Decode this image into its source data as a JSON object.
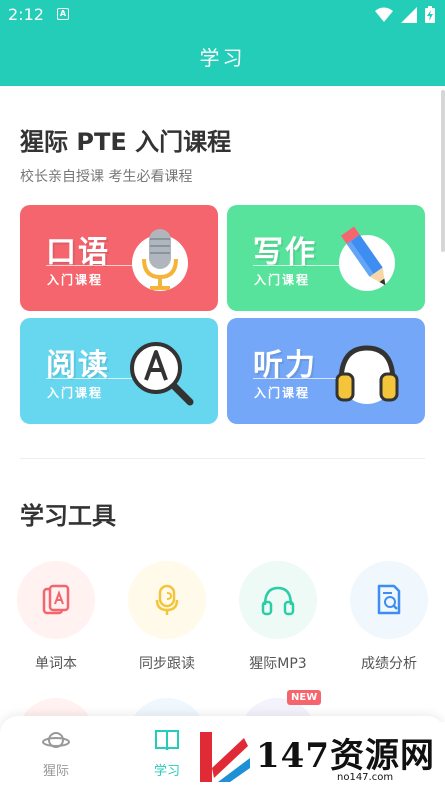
{
  "status_bar": {
    "time": "2:12",
    "notification_letter": "A"
  },
  "header": {
    "title": "学习"
  },
  "course_section": {
    "title": "猩际 PTE 入门课程",
    "subtitle": "校长亲自授课 考生必看课程",
    "cards": [
      {
        "title": "口语",
        "subtitle": "入门课程",
        "color": "#f4656e",
        "icon": "microphone-icon"
      },
      {
        "title": "写作",
        "subtitle": "入门课程",
        "color": "#58e39c",
        "icon": "pencil-icon"
      },
      {
        "title": "阅读",
        "subtitle": "入门课程",
        "color": "#67d6ef",
        "icon": "magnifier-icon"
      },
      {
        "title": "听力",
        "subtitle": "入门课程",
        "color": "#74a7f7",
        "icon": "headphones-icon"
      }
    ]
  },
  "tools_section": {
    "title": "学习工具",
    "tools": [
      {
        "label": "单词本",
        "icon": "word-card-icon"
      },
      {
        "label": "同步跟读",
        "icon": "follow-read-icon"
      },
      {
        "label": "猩际MP3",
        "icon": "headphones-icon"
      },
      {
        "label": "成绩分析",
        "icon": "report-search-icon"
      }
    ],
    "new_badge": "NEW"
  },
  "bottom_nav": {
    "items": [
      {
        "label": "猩际",
        "icon": "planet-icon"
      },
      {
        "label": "学习",
        "icon": "book-icon",
        "active": true
      }
    ]
  },
  "watermark": {
    "text": "147资源网",
    "url": "no147.com"
  },
  "colors": {
    "primary": "#23cdb8"
  }
}
